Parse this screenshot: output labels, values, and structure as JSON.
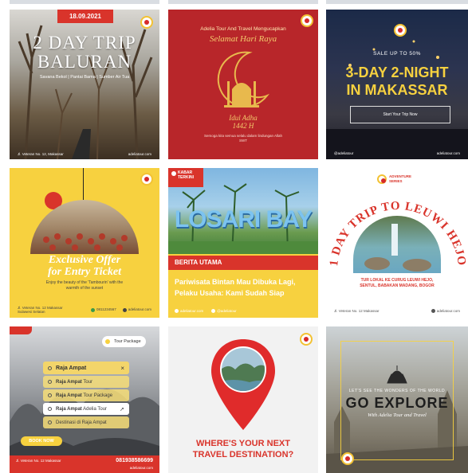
{
  "tile1": {
    "date": "18.09.2021",
    "title_line1": "2 DAY TRIP",
    "title_line2": "BALURAN",
    "subtitle": "Savana Bekol | Pantai Bama | Sumber Air Tua",
    "footer_left": "Jl. Veteran No. 12, Makassar",
    "footer_right": "adeliatour.com"
  },
  "tile2": {
    "header": "Adelia Tour And Travel Mengucapkan",
    "greeting": "Selamat Hari Raya",
    "occasion_line1": "Idul Adha",
    "occasion_line2": "1442 H",
    "wishes": "Semoga kita semua selalu dalam lindungan Allah SWT"
  },
  "tile3": {
    "sale": "SALE UP TO 50%",
    "title_line1": "3-DAY 2-NIGHT",
    "title_line2": "IN MAKASSAR",
    "cta": "Start Your Trip Now",
    "footer_left": "@adeliatour",
    "footer_right": "adeliatour.com"
  },
  "tile4": {
    "title_line1": "Exclusive Offer",
    "title_line2": "for Entry Ticket",
    "desc_line1": "Enjoy the beauty of the 'Tambourin' with the",
    "desc_line2": "warmth of the sunset",
    "footer_left": "Jl. Veteran No. 12 Makassar Sulawesi Selatan",
    "footer_mid": "0811234567",
    "footer_right": "adeliatour.com"
  },
  "tile5": {
    "badge_line1": "KABAR",
    "badge_line2": "TERKINI",
    "sign": "LOSARI BAY",
    "section": "BERITA UTAMA",
    "headline_line1": "Pariwisata Bintan Mau Dibuka Lagi,",
    "headline_line2": "Pelaku Usaha: Kami Sudah Siap",
    "footer_left": "adeliatour.com",
    "footer_right": "@adeliatour"
  },
  "tile6": {
    "badge_line1": "ADVENTURE",
    "badge_line2": "SERIES",
    "arc_title": "1 DAY TRIP TO LEUWI HEJO",
    "caption_line1": "TUR LOKAL KE CURUG LEUWI HEJO,",
    "caption_line2": "SENTUL, BABAKAN MADANG, BOGOR",
    "footer_left": "Jl. Veteran No. 12 Makassar",
    "footer_right": "adeliatour.com"
  },
  "tile7": {
    "tag": "Tour Package",
    "search_value": "Raja Ampat",
    "suggestions": [
      {
        "bold": "Raja Ampat",
        "rest": " Tour"
      },
      {
        "bold": "Raja Ampat",
        "rest": " Tour Package"
      },
      {
        "bold": "Raja Ampat",
        "rest": " Adelia Tour"
      },
      {
        "bold": "",
        "rest": "Destinasi di Raja Ampat"
      }
    ],
    "cta": "BOOK NOW",
    "phone": "081938586699",
    "footer_left": "Jl. Veteran No. 12 Makassar",
    "footer_right": "adeliatour.com"
  },
  "tile8": {
    "question_line1": "WHERE'S YOUR NEXT",
    "question_line2": "TRAVEL DESTINATION?"
  },
  "tile9": {
    "kicker": "LET'S SEE THE WONDERS OF THE WORLD",
    "title": "GO EXPLORE",
    "subtitle": "With Adelia Tour and Travel"
  },
  "colors": {
    "red": "#d9342b",
    "yellow": "#f7d13f",
    "dark_red": "#a81b26",
    "navy": "#1d2a44"
  }
}
